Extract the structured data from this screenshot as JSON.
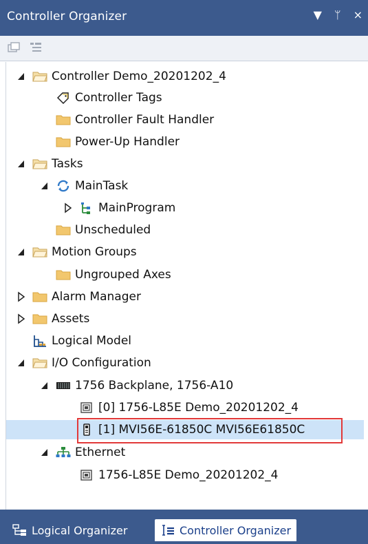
{
  "window": {
    "title": "Controller Organizer",
    "controls": [
      "▼",
      "ᛘ",
      "×"
    ]
  },
  "tree": {
    "nodes": [
      {
        "label": "Controller Demo_20201202_4",
        "level": 0,
        "expander": "expanded",
        "icon": "folder-open-icon"
      },
      {
        "label": "Controller Tags",
        "level": 1,
        "expander": "none",
        "icon": "tag-icon"
      },
      {
        "label": "Controller Fault Handler",
        "level": 1,
        "expander": "none",
        "icon": "folder-icon"
      },
      {
        "label": "Power-Up Handler",
        "level": 1,
        "expander": "none",
        "icon": "folder-icon"
      },
      {
        "label": "Tasks",
        "level": 0,
        "expander": "expanded",
        "icon": "folder-open-icon"
      },
      {
        "label": "MainTask",
        "level": 1,
        "expander": "expanded",
        "icon": "task-icon"
      },
      {
        "label": "MainProgram",
        "level": 2,
        "expander": "collapsed",
        "icon": "program-icon"
      },
      {
        "label": "Unscheduled",
        "level": 1,
        "expander": "none",
        "icon": "folder-icon"
      },
      {
        "label": "Motion Groups",
        "level": 0,
        "expander": "expanded",
        "icon": "folder-open-icon"
      },
      {
        "label": "Ungrouped Axes",
        "level": 1,
        "expander": "none",
        "icon": "folder-icon"
      },
      {
        "label": "Alarm Manager",
        "level": 0,
        "expander": "collapsed",
        "icon": "folder-icon"
      },
      {
        "label": "Assets",
        "level": 0,
        "expander": "collapsed",
        "icon": "folder-icon"
      },
      {
        "label": "Logical Model",
        "level": 0,
        "expander": "none",
        "icon": "logical-model-icon"
      },
      {
        "label": "I/O Configuration",
        "level": 0,
        "expander": "expanded",
        "icon": "folder-open-icon"
      },
      {
        "label": "1756 Backplane, 1756-A10",
        "level": 1,
        "expander": "expanded",
        "icon": "backplane-icon"
      },
      {
        "label": "[0] 1756-L85E Demo_20201202_4",
        "level": 2,
        "expander": "none",
        "icon": "controller-module-icon"
      },
      {
        "label": "[1] MVI56E-61850C MVI56E61850C",
        "level": 2,
        "expander": "none",
        "icon": "io-module-icon",
        "selected": true
      },
      {
        "label": "Ethernet",
        "level": 1,
        "expander": "expanded",
        "icon": "network-icon"
      },
      {
        "label": "1756-L85E Demo_20201202_4",
        "level": 2,
        "expander": "none",
        "icon": "controller-module-icon"
      }
    ]
  },
  "tabs": [
    {
      "label": "Logical Organizer",
      "active": false,
      "icon": "logical-organizer-icon"
    },
    {
      "label": "Controller Organizer",
      "active": true,
      "icon": "controller-organizer-icon"
    }
  ],
  "colors": {
    "title_bg": "#3c5a8d",
    "folder": "#f2c76e",
    "folder_open": "#f5dfa8",
    "selection": "#cde3f8",
    "highlight_border": "#e23838"
  }
}
